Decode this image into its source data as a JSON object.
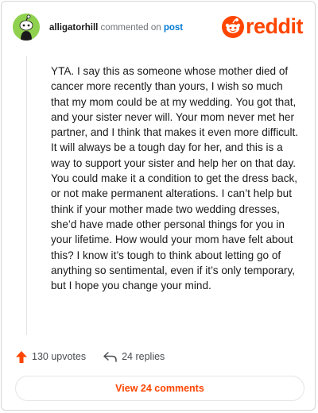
{
  "header": {
    "username": "alligatorhill",
    "action_text": "commented on",
    "post_link": "post",
    "logo_word": "reddit",
    "avatar_icon": "snoo-avatar-icon",
    "logo_icon": "reddit-snoo-icon"
  },
  "comment": {
    "body": "YTA. I say this as someone whose mother died of cancer more recently than yours, I wish so much that my mom could be at my wedding. You got that, and your sister never will. Your mom never met her partner, and I think that makes it even more difficult. It will always be a tough day for her, and this is a way to support your sister and help her on that day. You could make it a condition to get the dress back, or not make permanent alterations. I can’t help but think if your mother made two wedding dresses, she’d have made other personal things for you in your lifetime. How would your mom have felt about this? I know it’s tough to think about letting go of anything so sentimental, even if it’s only temporary, but I hope you change your mind."
  },
  "actions": {
    "upvotes": "130 upvotes",
    "replies": "24 replies",
    "upvote_icon": "upvote-arrow-icon",
    "reply_icon": "reply-arrow-icon"
  },
  "footer": {
    "view_comments": "View 24 comments"
  },
  "colors": {
    "brand": "#ff4500",
    "link": "#0079d3",
    "avatar": "#8fd14f",
    "text": "#1a1a1b",
    "muted": "#6f7376"
  }
}
